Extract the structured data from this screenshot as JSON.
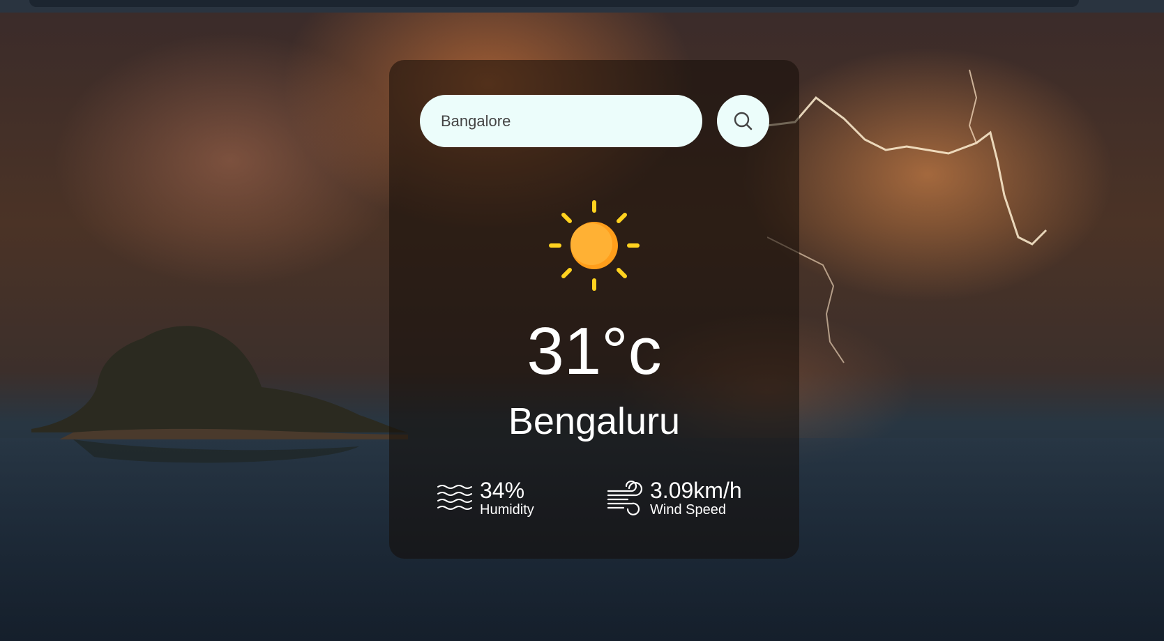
{
  "search": {
    "value": "Bangalore"
  },
  "weather": {
    "icon": "sun-icon",
    "temperature": "31°c",
    "city": "Bengaluru"
  },
  "details": {
    "humidity": {
      "value": "34%",
      "label": "Humidity",
      "icon": "humidity-waves-icon"
    },
    "wind": {
      "value": "3.09km/h",
      "label": "Wind Speed",
      "icon": "wind-icon"
    }
  },
  "colors": {
    "search_bg": "#ecfdfb",
    "sun": "#ffa92e",
    "sun_rays": "#ffd21f",
    "card_bg": "rgba(20,12,8,0.55)"
  }
}
